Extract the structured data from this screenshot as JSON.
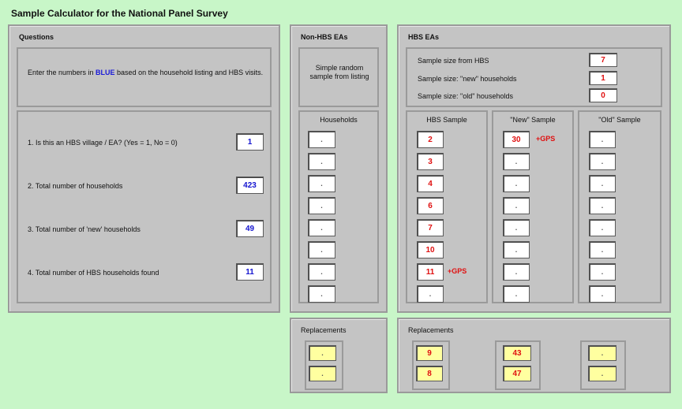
{
  "title": "Sample Calculator for the National Panel Survey",
  "questions": {
    "header": "Questions",
    "instruction_pre": "Enter the numbers in ",
    "instruction_blue": "BLUE",
    "instruction_post": " based on the household listing and HBS visits.",
    "items": [
      {
        "label": "1.  Is this an HBS village / EA?  (Yes = 1, No = 0)",
        "value": "1"
      },
      {
        "label": "2.  Total number of households",
        "value": "423"
      },
      {
        "label": "3.  Total number of 'new' households",
        "value": "49"
      },
      {
        "label": "4.  Total number of HBS households found",
        "value": "11"
      }
    ]
  },
  "non_hbs": {
    "header": "Non-HBS EAs",
    "method": "Simple random sample from listing",
    "households_header": "Households",
    "households": [
      ".",
      ".",
      ".",
      ".",
      ".",
      ".",
      ".",
      "."
    ],
    "replacements_header": "Replacements",
    "replacements": [
      ".",
      "."
    ]
  },
  "hbs": {
    "header": "HBS EAs",
    "summary": [
      {
        "label": "Sample size from HBS",
        "value": "7"
      },
      {
        "label": "Sample size: \"new\" households",
        "value": "1"
      },
      {
        "label": "Sample size: \"old\" households",
        "value": "0"
      }
    ],
    "hbs_sample_header": "HBS Sample",
    "hbs_sample": [
      "2",
      "3",
      "4",
      "6",
      "7",
      "10",
      "11",
      "."
    ],
    "hbs_sample_gps_index": 6,
    "new_sample_header": "\"New\" Sample",
    "new_sample": [
      "30",
      ".",
      ".",
      ".",
      ".",
      ".",
      ".",
      "."
    ],
    "new_sample_gps_index": 0,
    "old_sample_header": "\"Old\" Sample",
    "old_sample": [
      ".",
      ".",
      ".",
      ".",
      ".",
      ".",
      ".",
      "."
    ],
    "gps_label": "+GPS",
    "replacements_header": "Replacements",
    "replacements_hbs": [
      "9",
      "8"
    ],
    "replacements_new": [
      "43",
      "47"
    ],
    "replacements_old": [
      ".",
      "."
    ]
  },
  "colors": {
    "background": "#c8f6c8",
    "panel": "#c4c4c4",
    "input_blue": "#1515d0",
    "output_red": "#e01010",
    "replacement_yellow": "#ffffa0"
  }
}
